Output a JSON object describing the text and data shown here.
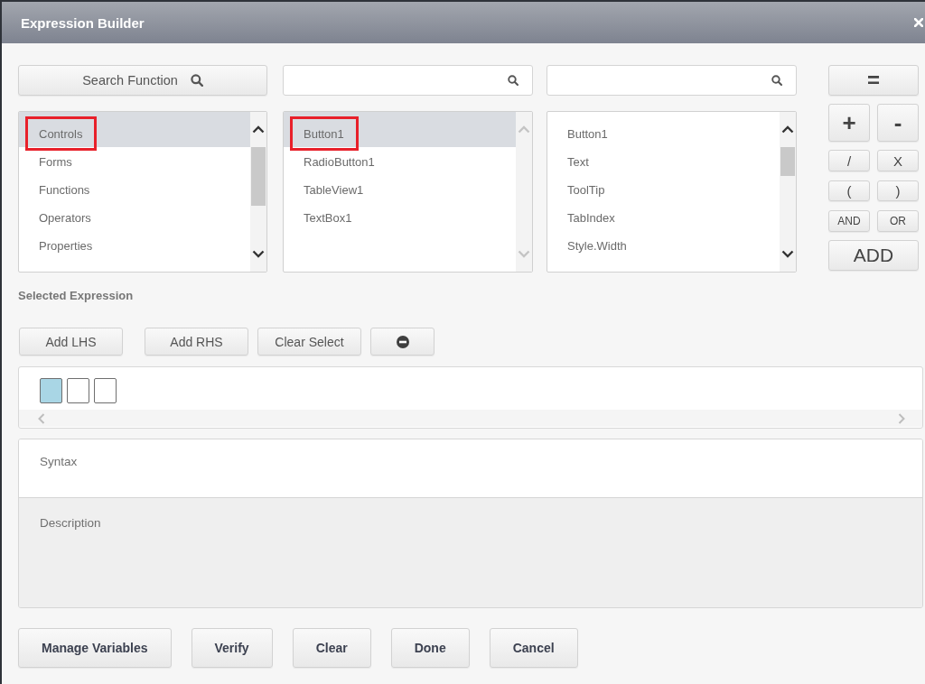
{
  "window": {
    "title": "Expression Builder"
  },
  "columns": [
    {
      "search": {
        "kind": "button",
        "label": "Search Function"
      },
      "list": {
        "scrollable": true,
        "items": [
          {
            "label": "Controls",
            "selected": true,
            "marked": true
          },
          {
            "label": "Forms",
            "selected": false,
            "marked": false
          },
          {
            "label": "Functions",
            "selected": false,
            "marked": false
          },
          {
            "label": "Operators",
            "selected": false,
            "marked": false
          },
          {
            "label": "Properties",
            "selected": false,
            "marked": false
          }
        ]
      }
    },
    {
      "search": {
        "kind": "field"
      },
      "list": {
        "scrollable": false,
        "items": [
          {
            "label": "Button1",
            "selected": true,
            "marked": true
          },
          {
            "label": "RadioButton1",
            "selected": false,
            "marked": false
          },
          {
            "label": "TableView1",
            "selected": false,
            "marked": false
          },
          {
            "label": "TextBox1",
            "selected": false,
            "marked": false
          }
        ]
      }
    },
    {
      "search": {
        "kind": "field"
      },
      "list": {
        "scrollable": true,
        "items": [
          {
            "label": "Button1",
            "selected": false,
            "marked": false
          },
          {
            "label": "Text",
            "selected": false,
            "marked": false
          },
          {
            "label": "ToolTip",
            "selected": false,
            "marked": false
          },
          {
            "label": "TabIndex",
            "selected": false,
            "marked": false
          },
          {
            "label": "Style.Width",
            "selected": false,
            "marked": false
          }
        ]
      }
    }
  ],
  "operator_pad": {
    "rows": [
      [
        {
          "label": "="
        }
      ],
      [
        {
          "label": "+"
        },
        {
          "label": "-"
        }
      ],
      [
        {
          "label": "/"
        },
        {
          "label": "X"
        }
      ],
      [
        {
          "label": "("
        },
        {
          "label": ")"
        }
      ],
      [
        {
          "label": "AND"
        },
        {
          "label": "OR"
        }
      ],
      [
        {
          "label": "ADD"
        }
      ]
    ]
  },
  "selected_expression": {
    "heading": "Selected Expression",
    "actions": [
      {
        "kind": "text",
        "label": "Add LHS"
      },
      {
        "kind": "text",
        "label": "Add RHS"
      },
      {
        "kind": "text",
        "label": "Clear Select"
      },
      {
        "kind": "icon"
      }
    ],
    "slots": [
      {
        "selected": true
      },
      {
        "selected": false
      },
      {
        "selected": false
      }
    ]
  },
  "syntax": {
    "label": "Syntax"
  },
  "description": {
    "label": "Description"
  },
  "footer_buttons": [
    {
      "label": "Manage Variables"
    },
    {
      "label": "Verify"
    },
    {
      "label": "Clear"
    },
    {
      "label": "Done"
    },
    {
      "label": "Cancel"
    }
  ]
}
